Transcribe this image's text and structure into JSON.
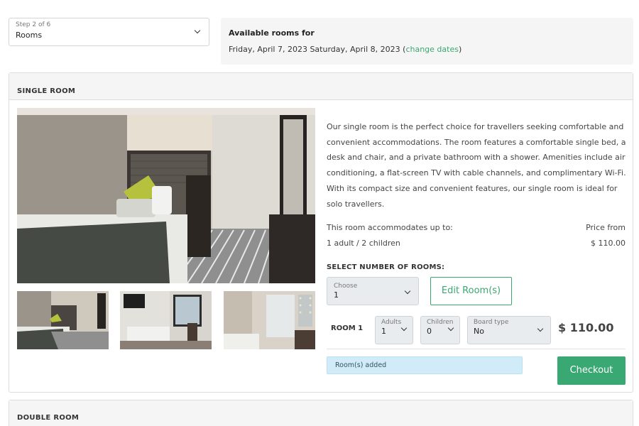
{
  "step_selector": {
    "label": "Step 2 of 6",
    "value": "Rooms"
  },
  "availability": {
    "title": "Available rooms for",
    "dates": "Friday, April 7, 2023 Saturday, April 8, 2023",
    "open_paren": "(",
    "change_link": "change dates",
    "close_paren": ")"
  },
  "rooms": [
    {
      "title": "SINGLE ROOM",
      "description": "Our single room is the perfect choice for travellers seeking comfortable and convenient accommodations. The room features a comfortable single bed, a desk and chair, and a private bathroom with a shower. Amenities include air conditioning, a flat-screen TV with cable channels, and complimentary Wi-Fi. With its compact size and convenient features, our single room is ideal for solo travellers.",
      "accommodates_label": "This room accommodates up to:",
      "accommodates_value": "1 adult / 2 children",
      "price_from_label": "Price from",
      "price_from_value": "$ 110.00",
      "select_heading": "SELECT NUMBER OF ROOMS:",
      "count_select": {
        "label": "Choose",
        "value": "1"
      },
      "edit_button": "Edit Room(s)",
      "room_line": {
        "label": "ROOM 1",
        "adults": {
          "label": "Adults",
          "value": "1"
        },
        "children": {
          "label": "Children",
          "value": "0"
        },
        "board": {
          "label": "Board type",
          "value": "No"
        },
        "price": "$ 110.00"
      },
      "status_message": "Room(s) added",
      "checkout_button": "Checkout"
    },
    {
      "title": "DOUBLE ROOM"
    }
  ],
  "icons": {
    "dropdown": "chevron-down-icon"
  },
  "colors": {
    "accent": "#3aa872",
    "info_bg": "#d1ecf8",
    "panel_bg": "#f5f5f5"
  }
}
